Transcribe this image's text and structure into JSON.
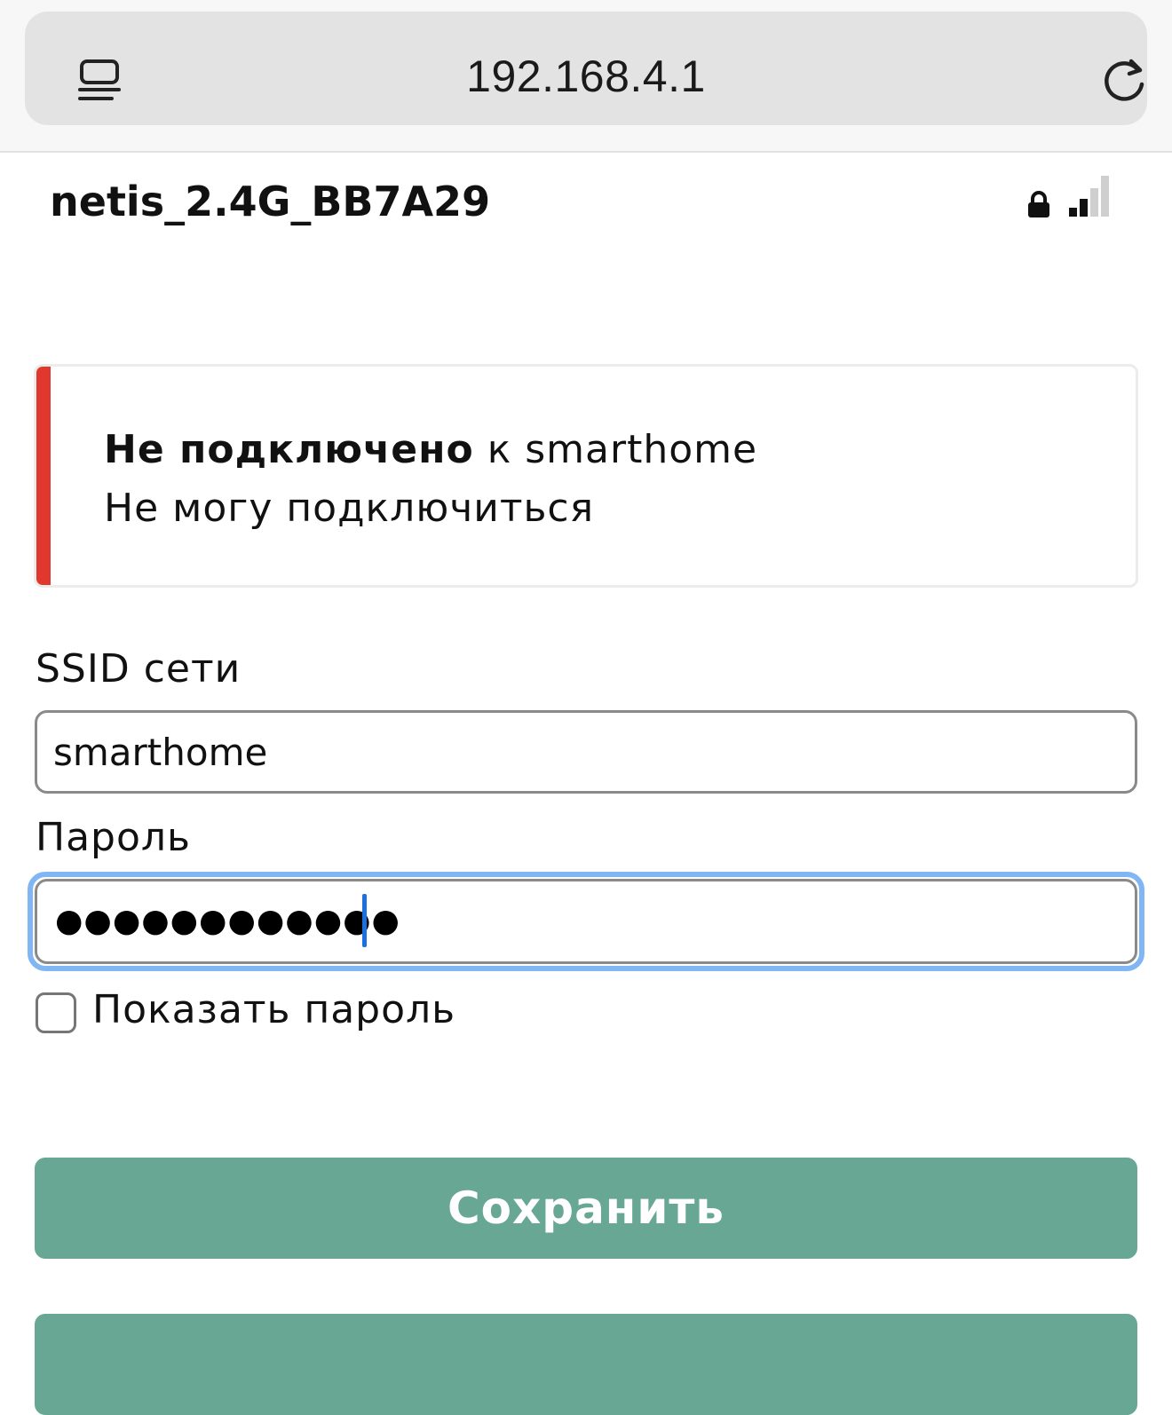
{
  "browser": {
    "url": "192.168.4.1",
    "icons": {
      "reader": "reader-mode-icon",
      "reload": "reload-icon"
    }
  },
  "network": {
    "name": "netis_2.4G_BB7A29",
    "icons": {
      "lock": "lock-icon",
      "signal": "signal-strength-icon"
    },
    "signal_bars_active": 2,
    "signal_bars_total": 4
  },
  "status": {
    "state_bold": "Не подключено",
    "state_rest": " к smarthome",
    "message": "Не могу подключиться",
    "accent_color": "#e0372f"
  },
  "form": {
    "ssid_label": "SSID сети",
    "ssid_value": "smarthome",
    "password_label": "Пароль",
    "password_masked": "●●●●●●●●●●●●",
    "show_password_label": "Показать пароль",
    "show_password_checked": false,
    "focus_color": "#80b6f4"
  },
  "buttons": {
    "save_label": "Сохранить",
    "button_color": "#67a794"
  }
}
